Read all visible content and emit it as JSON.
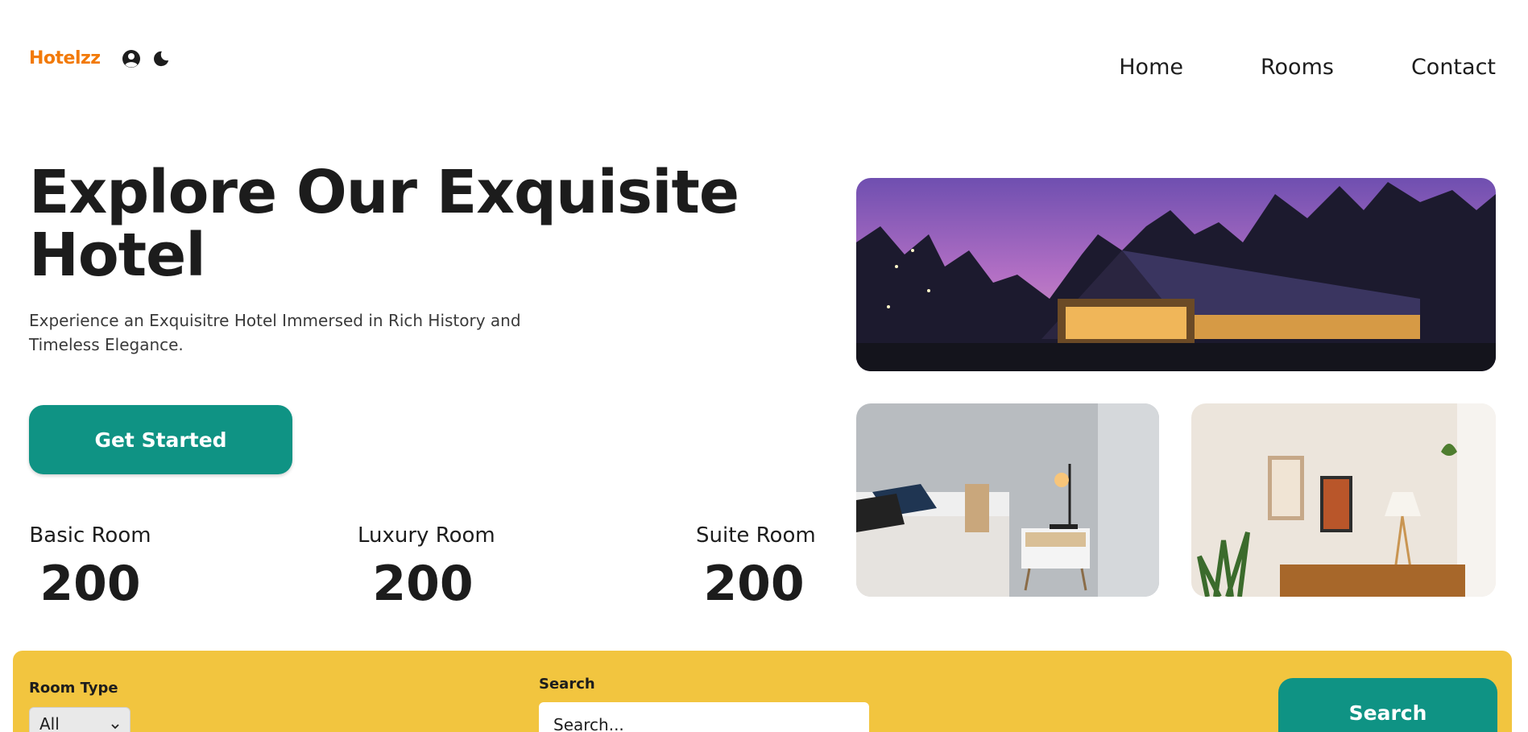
{
  "header": {
    "logo": "Hotelzz",
    "icons": [
      "user-circle-icon",
      "moon-icon"
    ],
    "nav": [
      "Home",
      "Rooms",
      "Contact"
    ]
  },
  "hero": {
    "title": "Explore Our Exquisite Hotel",
    "subtitle": "Experience an Exquisitre Hotel Immersed in Rich History and Timeless Elegance.",
    "cta_label": "Get Started"
  },
  "stats": [
    {
      "label": "Basic Room",
      "value": "200"
    },
    {
      "label": "Luxury Room",
      "value": "200"
    },
    {
      "label": "Suite Room",
      "value": "200"
    }
  ],
  "images": [
    "hotel-exterior-dusk",
    "bedroom",
    "living-room"
  ],
  "search": {
    "room_type_label": "Room Type",
    "room_type_value": "All",
    "search_label": "Search",
    "search_placeholder": "Search...",
    "button_label": "Search"
  },
  "colors": {
    "brand": "#f27a09",
    "primary": "#0f9384",
    "search_panel": "#f2c53f"
  }
}
